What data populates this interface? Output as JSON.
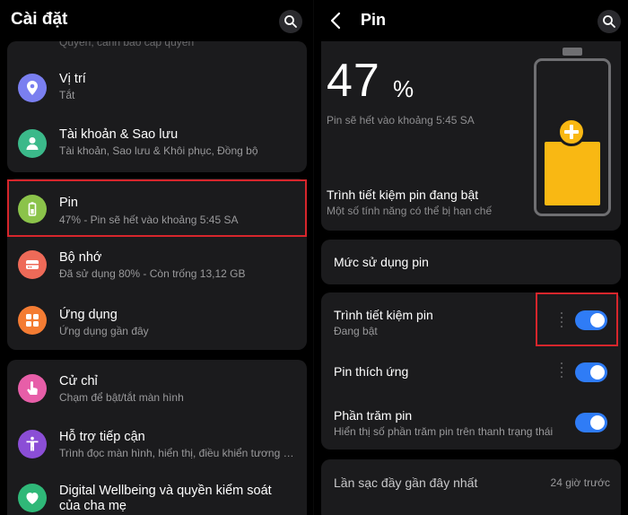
{
  "left_panel": {
    "title": "Cài đặt",
    "clipped_text": "Quyền, cảnh báo cấp quyền",
    "items": [
      {
        "title": "Vị trí",
        "subtitle": "Tắt",
        "icon": "location-icon",
        "color": "#7a7ff0"
      },
      {
        "title": "Tài khoản & Sao lưu",
        "subtitle": "Tài khoản, Sao lưu & Khôi phục, Đồng bộ",
        "icon": "account-icon",
        "color": "#3bb98a"
      },
      {
        "title": "Pin",
        "subtitle": "47% - Pin sẽ hết vào khoảng 5:45 SA",
        "icon": "battery-icon",
        "color": "#8bc34a"
      },
      {
        "title": "Bộ nhớ",
        "subtitle": "Đã sử dụng 80% - Còn trống 13,12 GB",
        "icon": "storage-icon",
        "color": "#ee6a58"
      },
      {
        "title": "Ứng dụng",
        "subtitle": "Ứng dụng gần đây",
        "icon": "apps-icon",
        "color": "#f47c33"
      },
      {
        "title": "Cử chỉ",
        "subtitle": "Chạm để bật/tắt màn hình",
        "icon": "gesture-icon",
        "color": "#e75ea8"
      },
      {
        "title": "Hỗ trợ tiếp cận",
        "subtitle": "Trình đọc màn hình, hiển thị, điều khiển tương t...",
        "icon": "accessibility-icon",
        "color": "#8b4ed6"
      },
      {
        "title": "Digital Wellbeing và quyền kiểm soát của cha mẹ",
        "subtitle": "",
        "icon": "wellbeing-icon",
        "color": "#2fb878"
      }
    ]
  },
  "right_panel": {
    "title": "Pin",
    "battery_level": 47,
    "percent_value": "47",
    "percent_sign": "%",
    "estimate": "Pin sẽ hết vào khoảng 5:45 SA",
    "saver_title": "Trình tiết kiệm pin đang bật",
    "saver_subtitle": "Một số tính năng có thể bị hạn chế",
    "usage_label": "Mức sử dụng pin",
    "toggles": [
      {
        "title": "Trình tiết kiệm pin",
        "subtitle": "Đang bật",
        "on": true
      },
      {
        "title": "Pin thích ứng",
        "subtitle": "",
        "on": true
      },
      {
        "title": "Phần trăm pin",
        "subtitle": "Hiển thị số phần trăm pin trên thanh trạng thái",
        "on": true
      }
    ],
    "last_charge_label": "Lần sạc đầy gần đây nhất",
    "last_charge_value": "24 giờ trước"
  },
  "colors": {
    "accent_toggle": "#2f7cf6",
    "battery_fill": "#f9b813",
    "highlight": "#d7262c",
    "card": "#1b1b1d"
  }
}
